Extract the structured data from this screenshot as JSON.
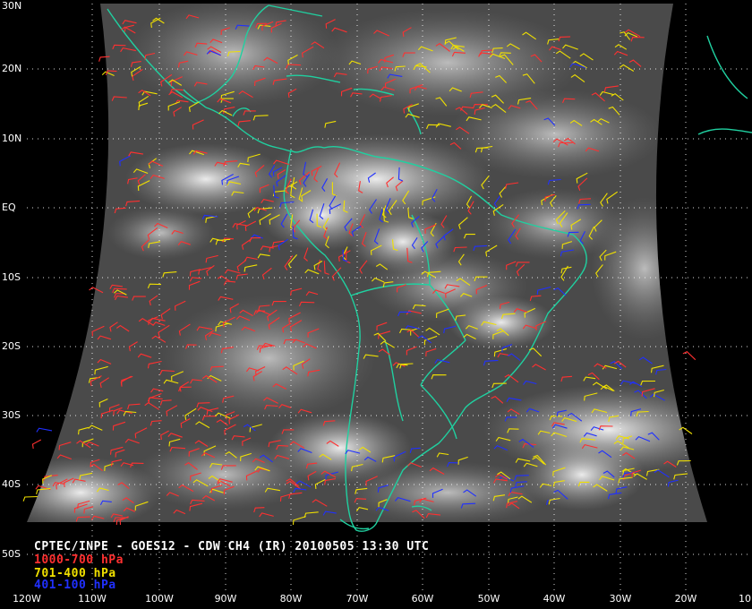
{
  "title": "CPTEC/INPE - GOES12 - CDW CH4 (IR) 20100505 13:30 UTC",
  "legend": [
    {
      "label": "1000-700 hPa",
      "color": "#ff3030"
    },
    {
      "label": "701-400 hPa",
      "color": "#f0e000"
    },
    {
      "label": "401-100 hPa",
      "color": "#2030ff"
    }
  ],
  "lat_labels": [
    "30N",
    "20N",
    "10N",
    "EQ",
    "10S",
    "20S",
    "30S",
    "40S",
    "50S"
  ],
  "lon_labels": [
    "120W",
    "110W",
    "100W",
    "90W",
    "80W",
    "70W",
    "60W",
    "50W",
    "40W",
    "30W",
    "20W",
    "10"
  ],
  "colors": {
    "coastline": "#20d0a0",
    "grid": "#ffffff",
    "background": "#000000"
  }
}
